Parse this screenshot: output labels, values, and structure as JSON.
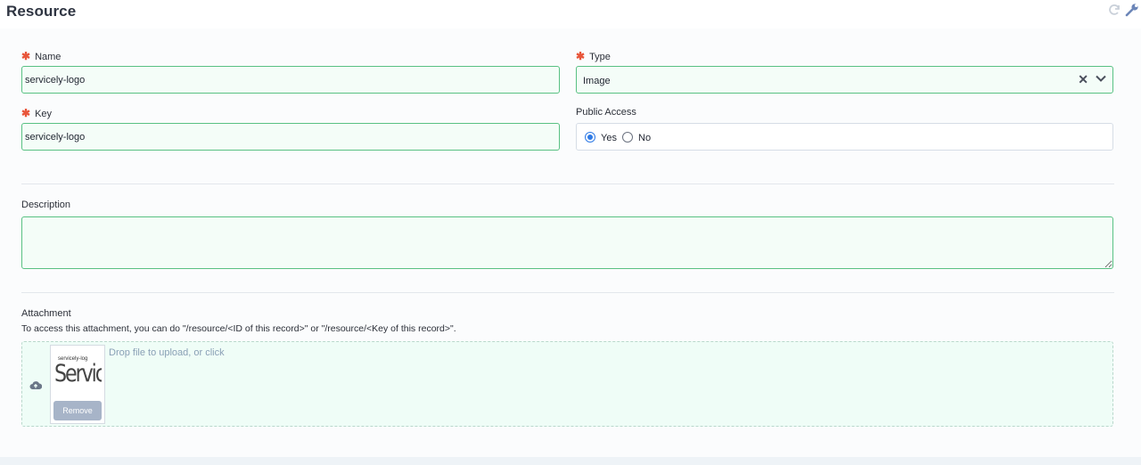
{
  "header": {
    "title": "Resource",
    "icons": [
      "refresh-icon",
      "wrench-icon"
    ]
  },
  "form": {
    "name": {
      "label": "Name",
      "required": true,
      "value": "servicely-logo"
    },
    "type": {
      "label": "Type",
      "required": true,
      "value": "Image"
    },
    "key": {
      "label": "Key",
      "required": true,
      "value": "servicely-logo"
    },
    "public_access": {
      "label": "Public Access",
      "options": [
        "Yes",
        "No"
      ],
      "selected": "Yes"
    },
    "description": {
      "label": "Description",
      "value": ""
    },
    "attachment": {
      "label": "Attachment",
      "help": "To access this attachment, you can do \"/resource/<ID of this record>\" or \"/resource/<Key of this record>\".",
      "drop_text": "Drop file to upload, or click",
      "thumbnail": {
        "caption": "servicely-log",
        "logo_text": "Servicely",
        "remove_label": "Remove"
      }
    }
  },
  "colors": {
    "accent": "#2f7ae5",
    "required": "#e8553a",
    "field_border": "#59c183",
    "field_bg": "#f4fdf8"
  }
}
